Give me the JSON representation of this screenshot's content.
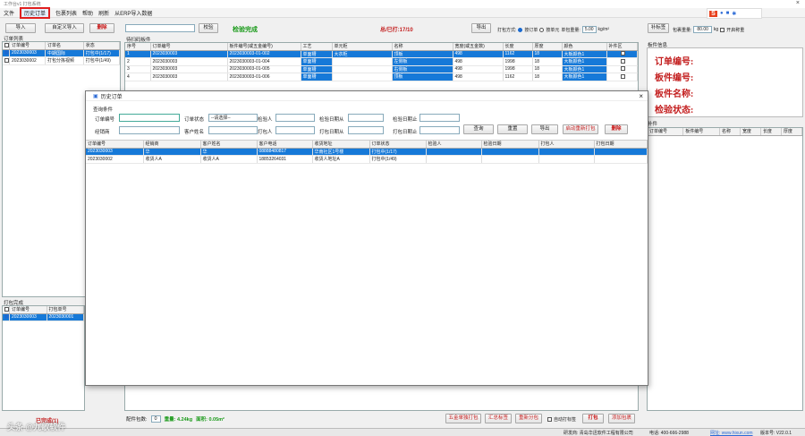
{
  "window": {
    "title": "工作台v1 打包系统",
    "close": "×"
  },
  "menu": [
    "文件",
    "历史订单",
    "包裹列表",
    "帮助",
    "刷新",
    "从ERP导入数据"
  ],
  "left": {
    "import_btn": "导入",
    "custom_import_btn": "自定义导入",
    "delete_btn": "删除",
    "order_list_title": "订单列表",
    "columns": [
      "订单编号",
      "订单名",
      "状态"
    ],
    "rows": [
      [
        "2023030003",
        "中期国际",
        "打包中(1/17)"
      ],
      [
        "2023030002",
        "打包分拣视频",
        "打包中(1/49)"
      ]
    ],
    "packed_title": "打包完成",
    "packed_columns": [
      "订单编号",
      "打包单号"
    ],
    "packed_rows": [
      [
        "2023030003",
        "2023030001"
      ]
    ],
    "footer": "已完成(1)"
  },
  "center": {
    "scan_btn": "校验",
    "verify_ok": "检验完成",
    "total_packed": "总/已打:17/10",
    "export_btn": "导出",
    "pack_mode_label": "打包方式:",
    "mode_a": "按订单",
    "mode_b": "按单元",
    "weight_label": "单包重量:",
    "weight_value": "5.00",
    "weight_unit": "kg/m²",
    "list_title": "待扫码板件",
    "columns": [
      "序号",
      "订单编号",
      "板件编号(或五金编号)",
      "工艺",
      "单元柜",
      "名称",
      "宽度(或五金数)",
      "长度",
      "厚度",
      "颜色",
      "补件区"
    ],
    "rows": [
      [
        "1",
        "2023030003",
        "2023030003-01-002",
        "单面槽",
        "大衣柜",
        "顶板",
        "498",
        "1162",
        "18",
        "大板颜色1"
      ],
      [
        "2",
        "2023030003",
        "2023030003-01-004",
        "单面槽",
        "",
        "左侧板",
        "498",
        "1998",
        "18",
        "大板颜色1"
      ],
      [
        "3",
        "2023030003",
        "2023030003-01-005",
        "单面槽",
        "",
        "右侧板",
        "498",
        "1998",
        "18",
        "大板颜色1"
      ],
      [
        "4",
        "2023030003",
        "2023030003-01-006",
        "单面槽",
        "",
        "顶板",
        "498",
        "1162",
        "18",
        "大板颜色1"
      ]
    ],
    "footer": {
      "pack_count_label": "配件包数:",
      "pack_count": "0",
      "weight": "重量: 4.24kg",
      "volume": "面积: 0.05m²",
      "btn1": "五金单独打包",
      "btn2": "汇总标签",
      "btn3": "重新分包",
      "auto_print": "自动打标签",
      "pack_btn": "打包",
      "add_pack_btn": "添加包裹"
    }
  },
  "right": {
    "reprint_btn": "补标签",
    "pkg_weight_label": "包裹重量:",
    "pkg_weight": "80.00",
    "kg": "kg",
    "scale_label": "开启称重",
    "info_title": "板件信息",
    "order_no": "订单编号:",
    "panel_no": "板件编号:",
    "panel_name": "板件名称:",
    "check_status": "检验状态:",
    "spare_title": "补件",
    "columns": [
      "订单编号",
      "板件编号",
      "名称",
      "宽度",
      "长度",
      "厚度"
    ]
  },
  "dialog": {
    "title": "历史订单",
    "query_title": "查询条件",
    "labels": {
      "order_no": "订单编号",
      "order_status": "订单状态",
      "checker": "检验人",
      "check_date_from": "检验日期从",
      "check_date_to": "检验日期止",
      "dealer": "经销商",
      "customer": "客户姓名",
      "packer": "打包人",
      "pack_date_from": "打包日期从",
      "pack_date_to": "打包日期止"
    },
    "status_select": "--请选择--",
    "buttons": {
      "query": "查询",
      "reset": "重置",
      "export": "导出",
      "reopen": "启动重新打包",
      "delete": "删除"
    },
    "columns": [
      "订单编号",
      "经销商",
      "客户姓名",
      "客户电话",
      "收货地址",
      "订单状态",
      "检验人",
      "检验日期",
      "打包人",
      "打包日期"
    ],
    "rows": [
      [
        "2023030003",
        "华",
        "华",
        "08888480817",
        "华南社区1号楼",
        "打包中(1/17)",
        "",
        "",
        "",
        ""
      ],
      [
        "2023030002",
        "收货人A",
        "收货人A",
        "18853264031",
        "收货人地址A",
        "打包中(1/49)",
        "",
        "",
        "",
        ""
      ]
    ]
  },
  "status_bar": {
    "company": "研发商: 青岛华迅软件工程有限公司",
    "phone": "电话: 400-666-2988",
    "website": "网址: www.hixun.com",
    "version": "版本号: V22.0.1"
  },
  "watermark": "头条 @九歌软件",
  "colors": {
    "accent": "#1679d8",
    "red": "#c31e1e",
    "green": "#1a9a1a"
  }
}
